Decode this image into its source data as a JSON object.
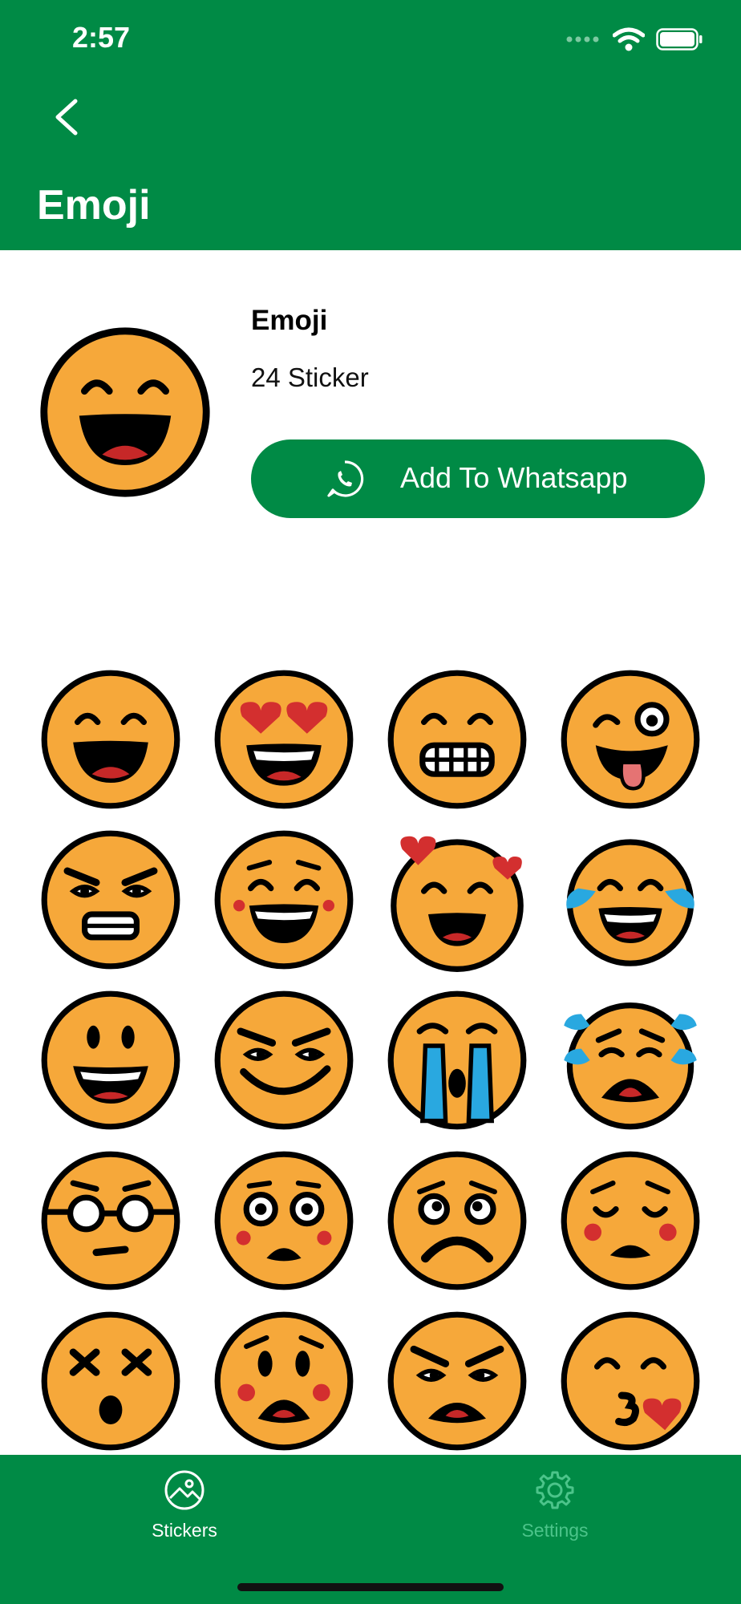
{
  "status_bar": {
    "time": "2:57"
  },
  "header": {
    "title": "Emoji"
  },
  "pack": {
    "name": "Emoji",
    "count": "24 Sticker",
    "add_button_label": "Add To Whatsapp"
  },
  "tabs": [
    {
      "label": "Stickers",
      "icon": "photo-icon",
      "active": true
    },
    {
      "label": "Settings",
      "icon": "gear-icon",
      "active": false
    }
  ],
  "colors": {
    "brand": "#008A45",
    "face": "#F6A83A",
    "inactive_tab": "#4CC48A"
  }
}
